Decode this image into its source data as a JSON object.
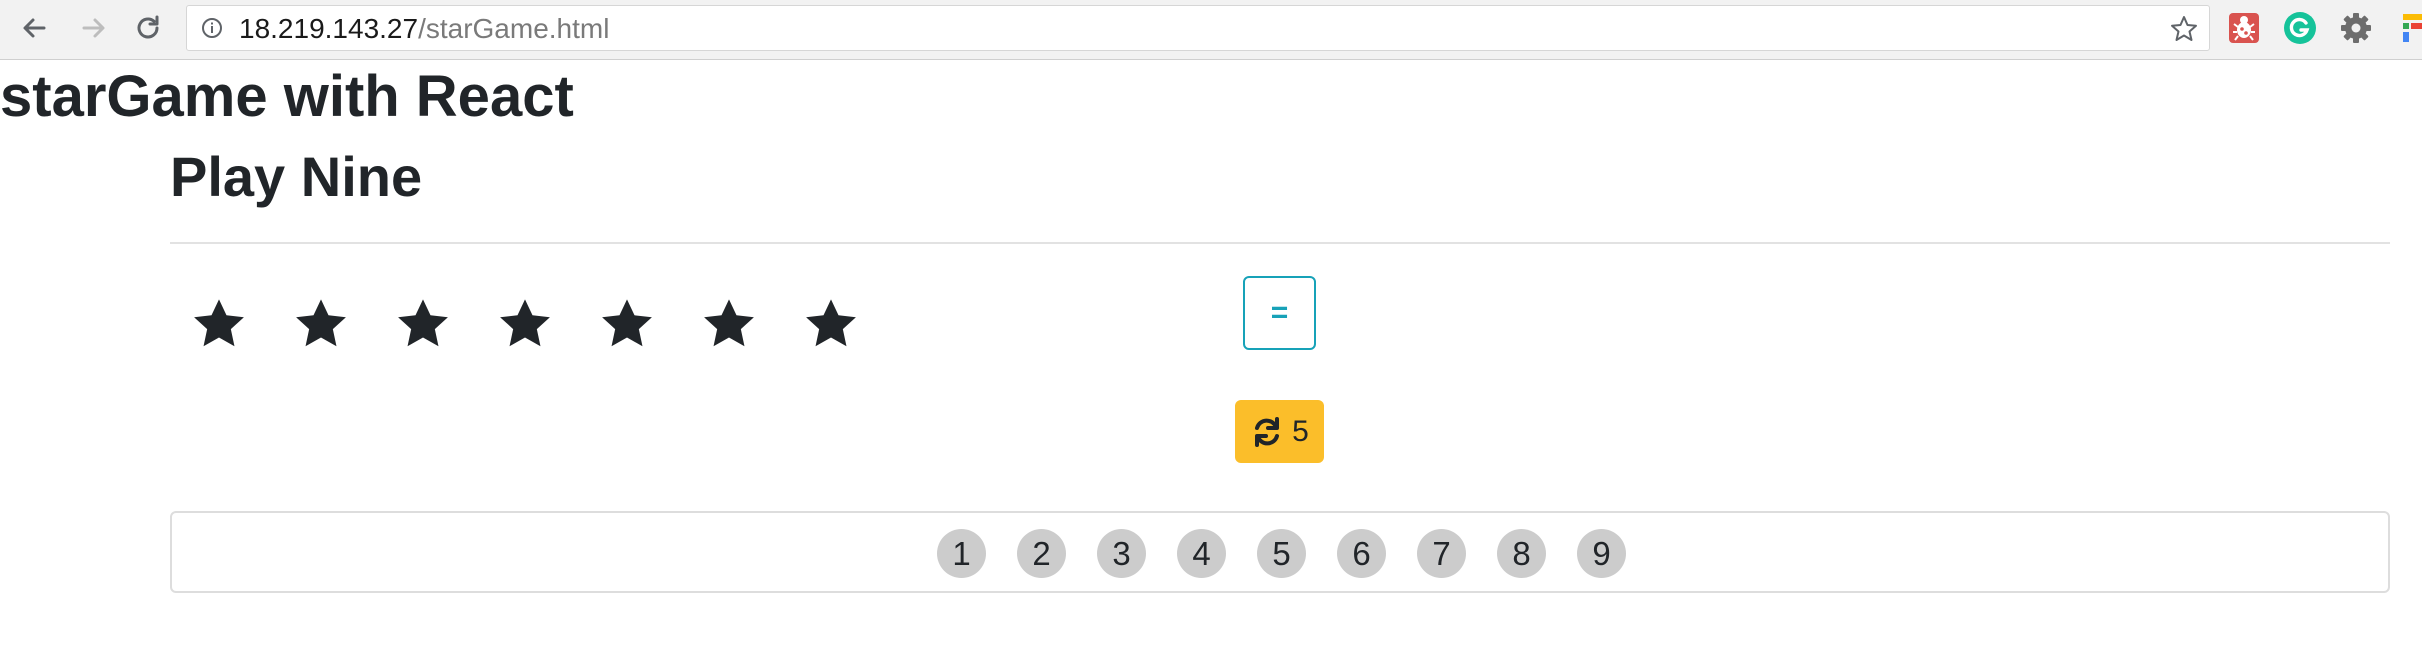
{
  "browser": {
    "url_host": "18.219.143.27",
    "url_path": "/starGame.html",
    "icons": {
      "back": "back-arrow-icon",
      "forward": "forward-arrow-icon",
      "reload": "reload-icon",
      "info": "info-icon",
      "bookmark": "star-outline-icon"
    },
    "extensions": [
      "bug-extension-icon",
      "grammarly-icon",
      "gear-extension-icon",
      "colorful-extension-icon"
    ]
  },
  "page": {
    "title": "starGame with React"
  },
  "game": {
    "title": "Play Nine",
    "stars_count": 7,
    "equals_label": "=",
    "redraw_count": "5",
    "numbers": [
      "1",
      "2",
      "3",
      "4",
      "5",
      "6",
      "7",
      "8",
      "9"
    ]
  },
  "colors": {
    "info": "#17a2b8",
    "warning": "#fbbe2a",
    "number_bg": "#cccccc",
    "text": "#212529"
  }
}
